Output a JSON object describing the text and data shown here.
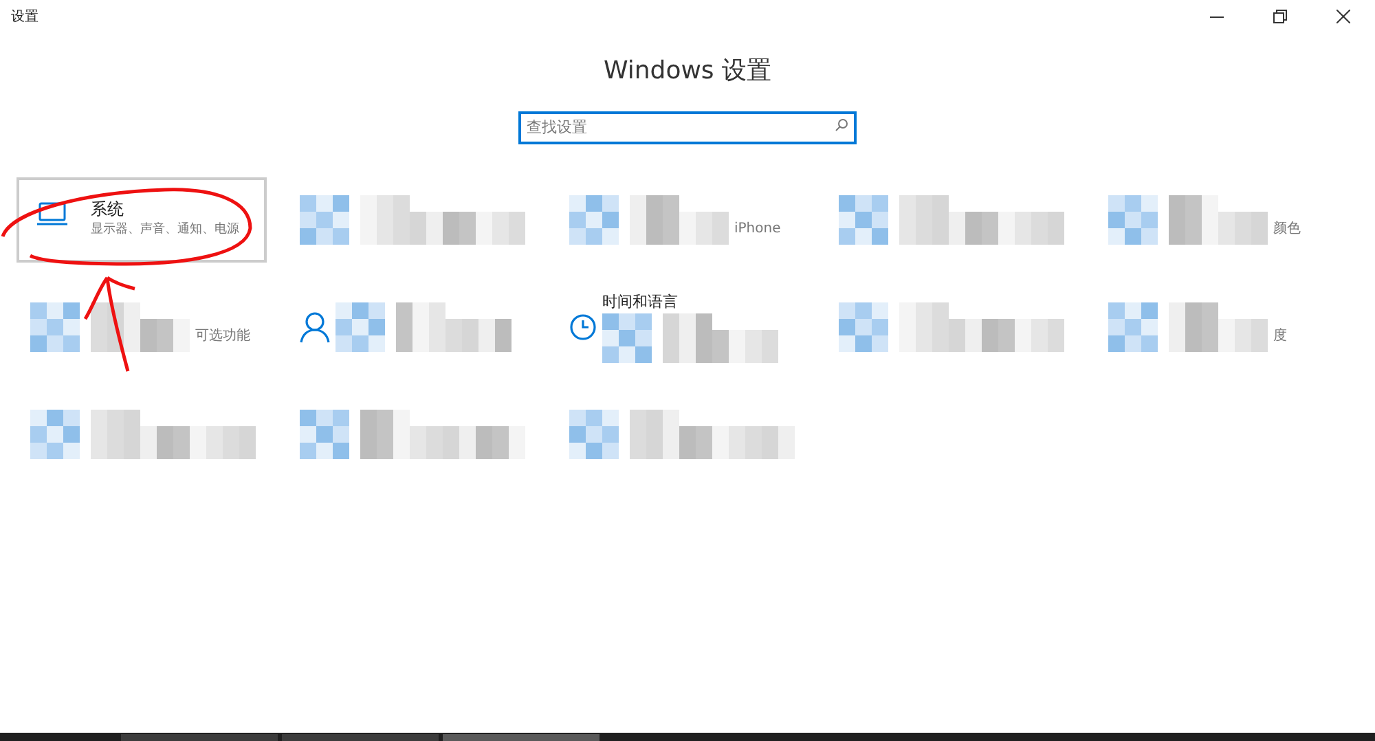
{
  "window": {
    "title": "设置"
  },
  "heading": "Windows 设置",
  "search": {
    "placeholder": "查找设置"
  },
  "tiles": [
    {
      "kind": "system",
      "title": "系统",
      "subtitle": "显示器、声音、通知、电源",
      "selected": true
    },
    {
      "kind": "mosaic",
      "selected": false
    },
    {
      "kind": "mosaic",
      "visible_text": "iPhone",
      "selected": false
    },
    {
      "kind": "mosaic",
      "selected": false
    },
    {
      "kind": "mosaic",
      "visible_text": "颜色",
      "selected": false
    },
    {
      "kind": "mosaic",
      "visible_text": "可选功能",
      "selected": false
    },
    {
      "kind": "account",
      "selected": false
    },
    {
      "kind": "time",
      "visible_title": "时间和语言",
      "selected": false
    },
    {
      "kind": "mosaic",
      "selected": false
    },
    {
      "kind": "mosaic",
      "visible_text": "度",
      "selected": false
    },
    {
      "kind": "mosaic",
      "selected": false
    },
    {
      "kind": "mosaic",
      "selected": false
    },
    {
      "kind": "mosaic",
      "selected": false
    }
  ],
  "annotations": [
    {
      "kind": "circle"
    },
    {
      "kind": "arrow"
    }
  ],
  "taskbar": {
    "buttons": [
      {
        "selected": false
      },
      {
        "selected": false
      },
      {
        "selected": true
      }
    ]
  }
}
